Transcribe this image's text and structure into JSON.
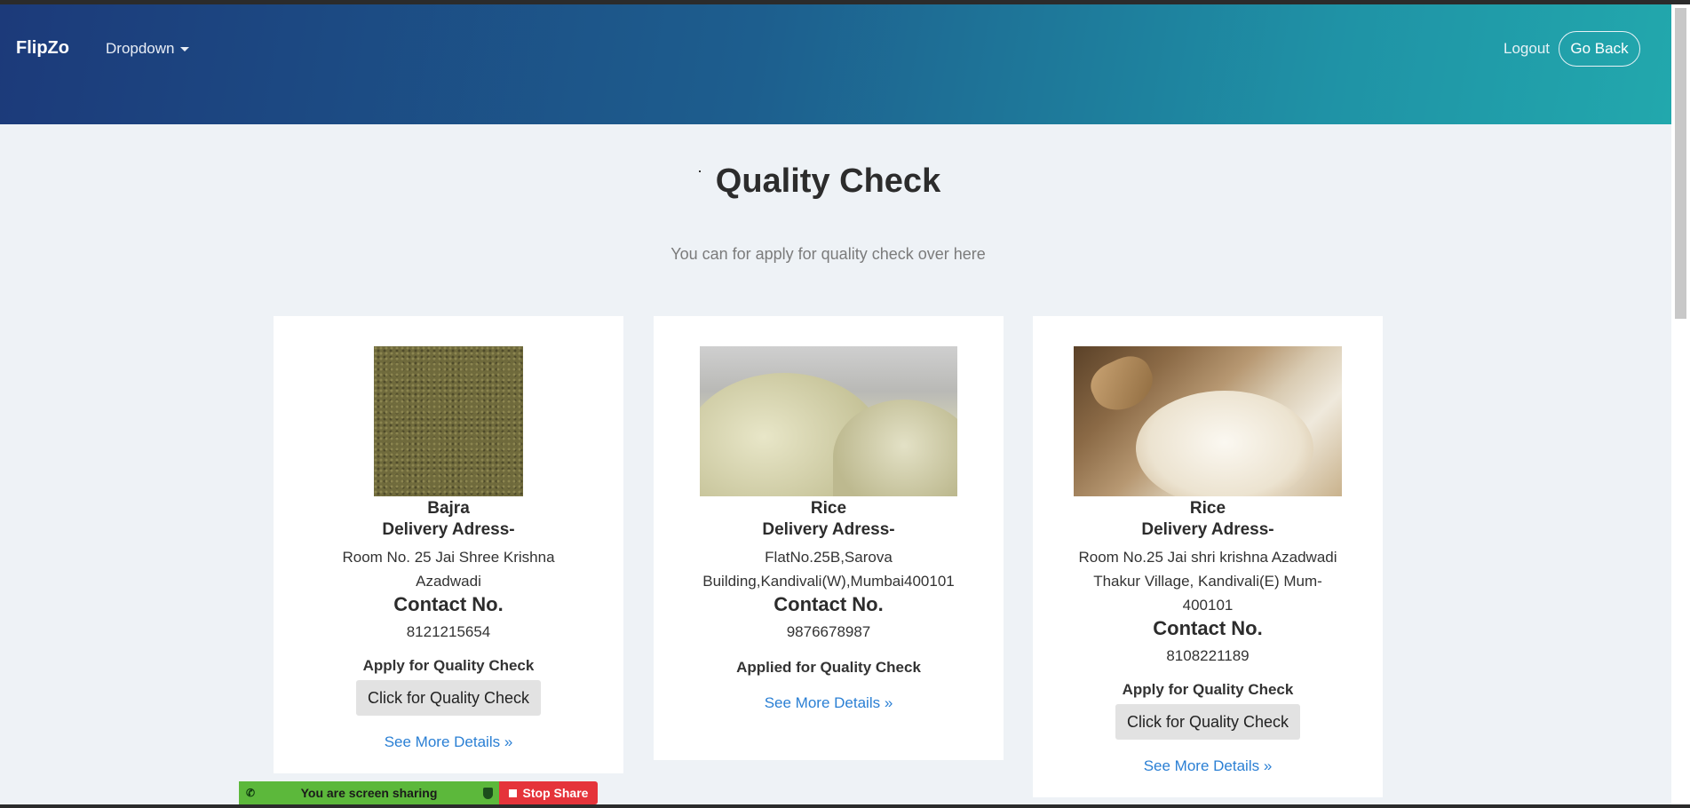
{
  "navbar": {
    "brand": "FlipZo",
    "dropdown_label": "Dropdown",
    "logout_label": "Logout",
    "goback_label": "Go Back",
    "gradient_start": "#1c3a7a",
    "gradient_end": "#22a8ad"
  },
  "header": {
    "title": "Quality Check",
    "subtitle": "You can for apply for quality check over here"
  },
  "cards": [
    {
      "product": "Bajra",
      "address_label": "Delivery Adress-",
      "address": "Room No. 25 Jai Shree Krishna Azadwadi",
      "contact_label": "Contact No.",
      "contact": "8121215654",
      "status_label": "Apply for Quality Check",
      "button_label": "Click for Quality Check",
      "more_label": "See More Details »"
    },
    {
      "product": "Rice",
      "address_label": "Delivery Adress-",
      "address": "FlatNo.25B,Sarova Building,Kandivali(W),Mumbai400101",
      "contact_label": "Contact No.",
      "contact": "9876678987",
      "status_label": "Applied for Quality Check",
      "more_label": "See More Details »"
    },
    {
      "product": "Rice",
      "address_label": "Delivery Adress-",
      "address": "Room No.25 Jai shri krishna Azadwadi Thakur Village, Kandivali(E) Mum-400101",
      "contact_label": "Contact No.",
      "contact": "8108221189",
      "status_label": "Apply for Quality Check",
      "button_label": "Click for Quality Check",
      "more_label": "See More Details »"
    }
  ],
  "screen_share": {
    "status_text": "You are screen sharing",
    "stop_label": "Stop Share",
    "bar_color": "#5cb83b",
    "stop_color": "#e5343a"
  },
  "icons": [
    "phone-icon",
    "shield-icon",
    "stop-icon",
    "caret-down-icon"
  ]
}
